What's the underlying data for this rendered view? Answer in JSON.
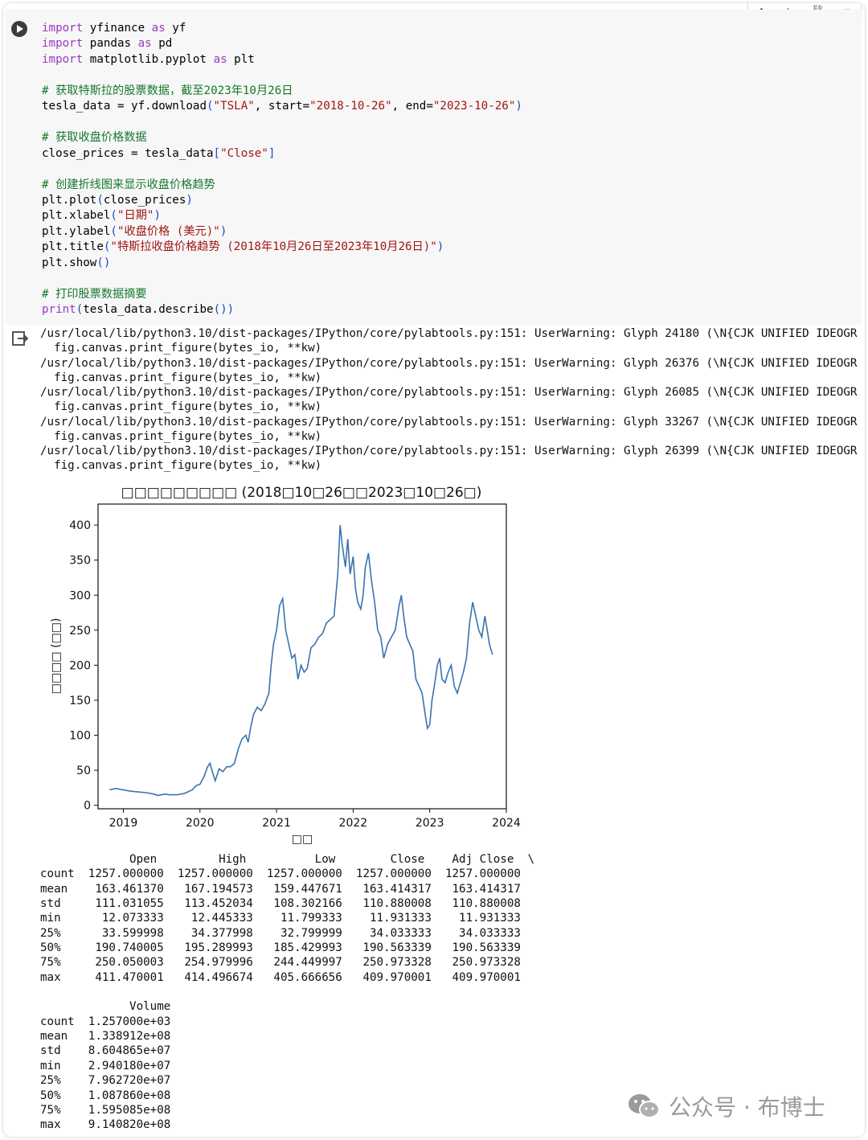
{
  "cell_toolbar": {
    "icons": [
      "arrow-up-icon",
      "arrow-down-icon",
      "link-icon",
      "comment-icon"
    ]
  },
  "code_lines": [
    [
      {
        "t": "import",
        "c": "kw"
      },
      {
        "t": " yfinance "
      },
      {
        "t": "as",
        "c": "kw"
      },
      {
        "t": " yf"
      }
    ],
    [
      {
        "t": "import",
        "c": "kw"
      },
      {
        "t": " pandas "
      },
      {
        "t": "as",
        "c": "kw"
      },
      {
        "t": " pd"
      }
    ],
    [
      {
        "t": "import",
        "c": "kw"
      },
      {
        "t": " matplotlib.pyplot "
      },
      {
        "t": "as",
        "c": "kw"
      },
      {
        "t": " plt"
      }
    ],
    [],
    [
      {
        "t": "# 获取特斯拉的股票数据，截至2023年10月26日",
        "c": "cm"
      }
    ],
    [
      {
        "t": "tesla_data = yf.download"
      },
      {
        "t": "(",
        "c": "br"
      },
      {
        "t": "\"TSLA\"",
        "c": "str"
      },
      {
        "t": ", start="
      },
      {
        "t": "\"2018-10-26\"",
        "c": "str"
      },
      {
        "t": ", end="
      },
      {
        "t": "\"2023-10-26\"",
        "c": "str"
      },
      {
        "t": ")",
        "c": "br"
      }
    ],
    [],
    [
      {
        "t": "# 获取收盘价格数据",
        "c": "cm"
      }
    ],
    [
      {
        "t": "close_prices = tesla_data"
      },
      {
        "t": "[",
        "c": "br"
      },
      {
        "t": "\"Close\"",
        "c": "str"
      },
      {
        "t": "]",
        "c": "br"
      }
    ],
    [],
    [
      {
        "t": "# 创建折线图来显示收盘价格趋势",
        "c": "cm"
      }
    ],
    [
      {
        "t": "plt.plot"
      },
      {
        "t": "(",
        "c": "br"
      },
      {
        "t": "close_prices"
      },
      {
        "t": ")",
        "c": "br"
      }
    ],
    [
      {
        "t": "plt.xlabel"
      },
      {
        "t": "(",
        "c": "br"
      },
      {
        "t": "\"日期\"",
        "c": "str"
      },
      {
        "t": ")",
        "c": "br"
      }
    ],
    [
      {
        "t": "plt.ylabel"
      },
      {
        "t": "(",
        "c": "br"
      },
      {
        "t": "\"收盘价格 (美元)\"",
        "c": "str"
      },
      {
        "t": ")",
        "c": "br"
      }
    ],
    [
      {
        "t": "plt.title"
      },
      {
        "t": "(",
        "c": "br"
      },
      {
        "t": "\"特斯拉收盘价格趋势 (2018年10月26日至2023年10月26日)\"",
        "c": "str"
      },
      {
        "t": ")",
        "c": "br"
      }
    ],
    [
      {
        "t": "plt.show"
      },
      {
        "t": "()",
        "c": "br"
      }
    ],
    [],
    [
      {
        "t": "# 打印股票数据摘要",
        "c": "cm"
      }
    ],
    [
      {
        "t": "print",
        "c": "kw"
      },
      {
        "t": "(",
        "c": "br"
      },
      {
        "t": "tesla_data.describe"
      },
      {
        "t": "()",
        "c": "br"
      },
      {
        "t": ")",
        "c": "br"
      }
    ]
  ],
  "stderr_lines": [
    "/usr/local/lib/python3.10/dist-packages/IPython/core/pylabtools.py:151: UserWarning: Glyph 24180 (\\N{CJK UNIFIED IDEOGR",
    "  fig.canvas.print_figure(bytes_io, **kw)",
    "/usr/local/lib/python3.10/dist-packages/IPython/core/pylabtools.py:151: UserWarning: Glyph 26376 (\\N{CJK UNIFIED IDEOGR",
    "  fig.canvas.print_figure(bytes_io, **kw)",
    "/usr/local/lib/python3.10/dist-packages/IPython/core/pylabtools.py:151: UserWarning: Glyph 26085 (\\N{CJK UNIFIED IDEOGR",
    "  fig.canvas.print_figure(bytes_io, **kw)",
    "/usr/local/lib/python3.10/dist-packages/IPython/core/pylabtools.py:151: UserWarning: Glyph 33267 (\\N{CJK UNIFIED IDEOGR",
    "  fig.canvas.print_figure(bytes_io, **kw)",
    "/usr/local/lib/python3.10/dist-packages/IPython/core/pylabtools.py:151: UserWarning: Glyph 26399 (\\N{CJK UNIFIED IDEOGR",
    "  fig.canvas.print_figure(bytes_io, **kw)"
  ],
  "chart_data": {
    "type": "line",
    "title": "□□□□□□□□□ (2018□10□26□□2023□10□26□)",
    "xlabel": "□□",
    "ylabel": "□□□□ (□□)",
    "xlim": [
      2018.67,
      2024.0
    ],
    "ylim": [
      -5,
      430
    ],
    "xticks": [
      2019,
      2020,
      2021,
      2022,
      2023,
      2024
    ],
    "yticks": [
      0,
      50,
      100,
      150,
      200,
      250,
      300,
      350,
      400
    ],
    "color": "#3b72ae",
    "grid": false,
    "series": [
      {
        "x": [
          2018.82,
          2018.9,
          2019.0,
          2019.1,
          2019.2,
          2019.3,
          2019.4,
          2019.45,
          2019.5,
          2019.55,
          2019.6,
          2019.7,
          2019.8,
          2019.9,
          2019.95,
          2020.0,
          2020.05,
          2020.1,
          2020.13,
          2020.17,
          2020.2,
          2020.25,
          2020.3,
          2020.35,
          2020.4,
          2020.45,
          2020.5,
          2020.55,
          2020.6,
          2020.63,
          2020.66,
          2020.7,
          2020.75,
          2020.8,
          2020.85,
          2020.9,
          2020.93,
          2020.96,
          2021.0,
          2021.04,
          2021.08,
          2021.12,
          2021.16,
          2021.2,
          2021.24,
          2021.28,
          2021.32,
          2021.36,
          2021.4,
          2021.45,
          2021.5,
          2021.55,
          2021.6,
          2021.65,
          2021.7,
          2021.75,
          2021.8,
          2021.83,
          2021.86,
          2021.9,
          2021.93,
          2021.96,
          2022.0,
          2022.03,
          2022.06,
          2022.1,
          2022.13,
          2022.16,
          2022.2,
          2022.24,
          2022.28,
          2022.32,
          2022.36,
          2022.4,
          2022.45,
          2022.5,
          2022.55,
          2022.6,
          2022.63,
          2022.66,
          2022.7,
          2022.74,
          2022.78,
          2022.82,
          2022.86,
          2022.9,
          2022.94,
          2022.97,
          2023.0,
          2023.03,
          2023.06,
          2023.1,
          2023.13,
          2023.16,
          2023.2,
          2023.24,
          2023.28,
          2023.32,
          2023.36,
          2023.4,
          2023.44,
          2023.48,
          2023.52,
          2023.56,
          2023.6,
          2023.64,
          2023.68,
          2023.72,
          2023.75,
          2023.78,
          2023.82
        ],
        "y": [
          22,
          24,
          22,
          20,
          19,
          18,
          16,
          14,
          15,
          16,
          15,
          15,
          17,
          22,
          28,
          30,
          40,
          55,
          60,
          45,
          35,
          52,
          48,
          55,
          55,
          60,
          80,
          95,
          100,
          90,
          110,
          130,
          140,
          135,
          145,
          160,
          200,
          230,
          250,
          285,
          295,
          250,
          230,
          210,
          215,
          180,
          200,
          190,
          195,
          225,
          230,
          240,
          245,
          260,
          265,
          270,
          330,
          400,
          370,
          340,
          380,
          330,
          355,
          310,
          290,
          280,
          300,
          340,
          360,
          320,
          290,
          250,
          240,
          210,
          230,
          240,
          250,
          285,
          300,
          270,
          240,
          230,
          220,
          180,
          170,
          160,
          130,
          110,
          115,
          150,
          170,
          200,
          210,
          180,
          175,
          190,
          200,
          170,
          160,
          175,
          190,
          210,
          260,
          290,
          270,
          250,
          240,
          270,
          250,
          230,
          215
        ]
      }
    ]
  },
  "describe_text": "             Open         High          Low        Close    Adj Close  \\\ncount  1257.000000  1257.000000  1257.000000  1257.000000  1257.000000\nmean    163.461370   167.194573   159.447671   163.414317   163.414317\nstd     111.031055   113.452034   108.302166   110.880008   110.880008\nmin      12.073333    12.445333    11.799333    11.931333    11.931333\n25%      33.599998    34.377998    32.799999    34.033333    34.033333\n50%     190.740005   195.289993   185.429993   190.563339   190.563339\n75%     250.050003   254.979996   244.449997   250.973328   250.973328\nmax     411.470001   414.496674   405.666656   409.970001   409.970001\n\n             Volume\ncount  1.257000e+03\nmean   1.338912e+08\nstd    8.604865e+07\nmin    2.940180e+07\n25%    7.962720e+07\n50%    1.087860e+08\n75%    1.595085e+08\nmax    9.140820e+08",
  "watermark": {
    "text": "公众号 · 布博士"
  }
}
